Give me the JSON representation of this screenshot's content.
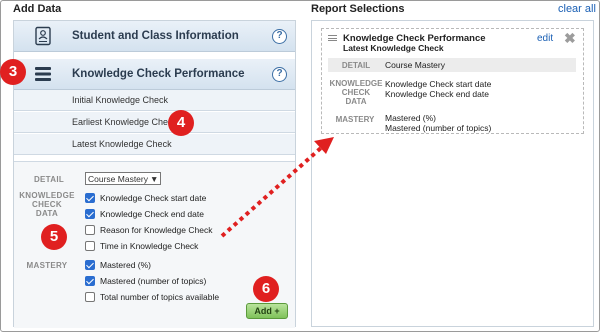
{
  "left_section": {
    "title": "Add Data"
  },
  "right_section": {
    "title": "Report Selections",
    "clear_all": "clear all"
  },
  "categories": [
    {
      "label": "Student and Class Information",
      "icon": "id-card-icon",
      "help": "?"
    },
    {
      "label": "Knowledge Check Performance",
      "icon": "list-icon",
      "help": "?"
    }
  ],
  "sub_items": [
    "Initial Knowledge Check",
    "Earliest Knowledge Check",
    "Latest Knowledge Check"
  ],
  "detail": {
    "label": "DETAIL",
    "selected": "Course Mastery"
  },
  "knowledge_check_data": {
    "label_lines": [
      "KNOWLEDGE",
      "CHECK",
      "DATA"
    ],
    "options": [
      {
        "label": "Knowledge Check start date",
        "checked": true
      },
      {
        "label": "Knowledge Check end date",
        "checked": true
      },
      {
        "label": "Reason for Knowledge Check",
        "checked": false
      },
      {
        "label": "Time in Knowledge Check",
        "checked": false
      }
    ]
  },
  "mastery": {
    "label": "MASTERY",
    "options": [
      {
        "label": "Mastered (%)",
        "checked": true
      },
      {
        "label": "Mastered (number of topics)",
        "checked": true
      },
      {
        "label": "Total number of topics available",
        "checked": false
      }
    ]
  },
  "add_button": "Add +",
  "report_card": {
    "title": "Knowledge Check Performance",
    "subtitle": "Latest Knowledge Check",
    "edit": "edit",
    "close": "✖",
    "detail_label": "DETAIL",
    "detail_value": "Course Mastery",
    "kc_label_lines": [
      "KNOWLEDGE",
      "CHECK",
      "DATA"
    ],
    "kc_values": [
      "Knowledge Check start date",
      "Knowledge Check end date"
    ],
    "mastery_label": "MASTERY",
    "mastery_values": [
      "Mastered (%)",
      "Mastered (number of topics)"
    ]
  },
  "step_badges": [
    "3",
    "4",
    "5",
    "6"
  ],
  "colors": {
    "badge": "#e02020",
    "link": "#1a5fb4",
    "checkbox": "#2a6dd0",
    "add_button": "#8ccb66"
  }
}
